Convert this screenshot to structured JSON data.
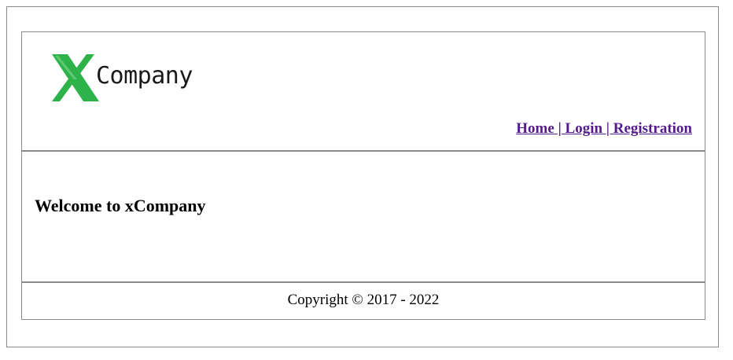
{
  "header": {
    "logo_text": "Company",
    "logo_mark_color": "#2db34a",
    "nav": {
      "home": "Home",
      "login": "Login",
      "registration": "Registration",
      "separator": " | "
    }
  },
  "main": {
    "welcome": "Welcome to xCompany"
  },
  "footer": {
    "copyright": "Copyright © 2017 - 2022"
  }
}
